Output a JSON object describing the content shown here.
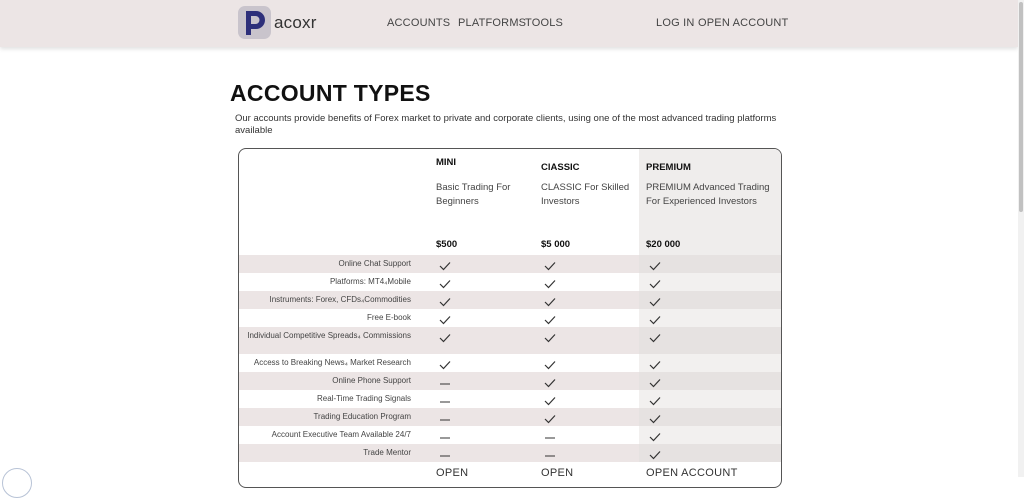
{
  "header": {
    "logo_text": "acoxr",
    "nav": [
      {
        "id": "accounts",
        "label": "ACCOUNTS"
      },
      {
        "id": "platforms",
        "label": "PLATFORMS"
      },
      {
        "id": "tools",
        "label": "TOOLS"
      },
      {
        "id": "login",
        "label": "LOG IN"
      },
      {
        "id": "open-account",
        "label": "OPEN ACCOUNT"
      }
    ]
  },
  "page": {
    "title": "ACCOUNT TYPES",
    "intro": "Our accounts provide benefits of Forex market to private and corporate clients, using one of the most advanced trading platforms available"
  },
  "plans": [
    {
      "id": "mini",
      "name": "MINI",
      "desc": "Basic Trading For Beginners",
      "price": "$500",
      "open_label": "OPEN"
    },
    {
      "id": "classic",
      "name": "ClASSIC",
      "desc": "CLASSIC For Skilled Investors",
      "price": "$5 000",
      "open_label": "OPEN"
    },
    {
      "id": "premium",
      "name": "PREMIUM",
      "desc": "PREMIUM Advanced Trading For Experienced Investors",
      "price": "$20 000",
      "open_label": "OPEN ACCOUNT"
    }
  ],
  "features": [
    {
      "label": "Online Chat Support",
      "values": [
        "check",
        "check",
        "check"
      ]
    },
    {
      "label": "Platforms: MT4⁠₄Mobile",
      "values": [
        "check",
        "check",
        "check"
      ]
    },
    {
      "label": "Instruments: Forex, CFDs⁠₄Commodities",
      "values": [
        "check",
        "check",
        "check"
      ]
    },
    {
      "label": "Free E-book",
      "values": [
        "check",
        "check",
        "check"
      ]
    },
    {
      "label": "Individual Competitive Spreads⁠₄ Commissions",
      "values": [
        "check",
        "check",
        "check"
      ]
    },
    {
      "label": "Access to Breaking News⁠₄ Market Research",
      "values": [
        "check",
        "check",
        "check"
      ]
    },
    {
      "label": "Online Phone Support",
      "values": [
        "dash",
        "check",
        "check"
      ]
    },
    {
      "label": "Real-Time Trading Signals",
      "values": [
        "dash",
        "check",
        "check"
      ]
    },
    {
      "label": "Trading Education Program",
      "values": [
        "dash",
        "check",
        "check"
      ]
    },
    {
      "label": "Account Executive Team Available 24/7",
      "values": [
        "dash",
        "dash",
        "check"
      ]
    },
    {
      "label": "Trade Mentor",
      "values": [
        "dash",
        "dash",
        "check"
      ]
    }
  ],
  "icons": {
    "check": "check-icon",
    "dash": "dash-icon",
    "logo": "p-logo-icon"
  },
  "colors": {
    "header_bg": "#ece5e5",
    "row_shade": "#ece5e5",
    "logo_mark": "#2d2f7a"
  }
}
